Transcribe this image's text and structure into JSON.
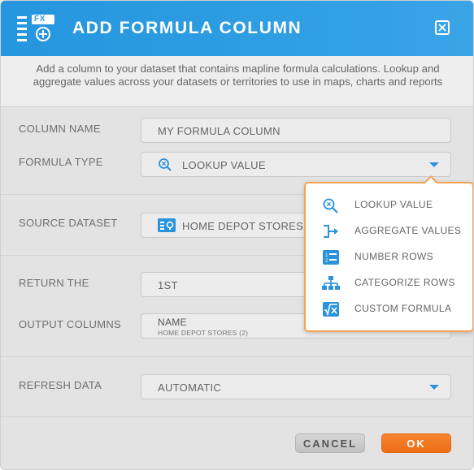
{
  "header": {
    "icon_badge": "FX",
    "title": "ADD FORMULA COLUMN"
  },
  "intro": {
    "text": "Add a column to your dataset that contains mapline formula calculations. Lookup and aggregate values across your datasets or territories to use in maps, charts and reports"
  },
  "form": {
    "column_name": {
      "label": "COLUMN NAME",
      "value": "MY FORMULA COLUMN"
    },
    "formula_type": {
      "label": "FORMULA TYPE",
      "value": "LOOKUP VALUE",
      "icon": "lookup-icon"
    },
    "source_dataset": {
      "label": "SOURCE DATASET",
      "value": "HOME DEPOT STORES",
      "icon": "dataset-icon"
    },
    "return_the": {
      "label": "RETURN THE",
      "value": "1ST"
    },
    "output_columns": {
      "label": "OUTPUT COLUMNS",
      "name": "NAME",
      "source": "HOME DEPOT STORES (2)"
    },
    "refresh_data": {
      "label": "REFRESH DATA",
      "value": "AUTOMATIC"
    }
  },
  "dropdown": {
    "items": [
      {
        "label": "LOOKUP VALUE",
        "icon": "lookup-icon"
      },
      {
        "label": "AGGREGATE VALUES",
        "icon": "aggregate-icon"
      },
      {
        "label": "NUMBER ROWS",
        "icon": "number-rows-icon"
      },
      {
        "label": "CATEGORIZE ROWS",
        "icon": "categorize-icon"
      },
      {
        "label": "CUSTOM FORMULA",
        "icon": "custom-formula-icon"
      }
    ]
  },
  "footer": {
    "cancel_label": "CANCEL",
    "ok_label": "OK"
  },
  "colors": {
    "header_blue": "#2f9ee3",
    "accent_blue": "#2b93db",
    "ok_orange": "#f07a22",
    "dropdown_border": "#f6a353"
  }
}
